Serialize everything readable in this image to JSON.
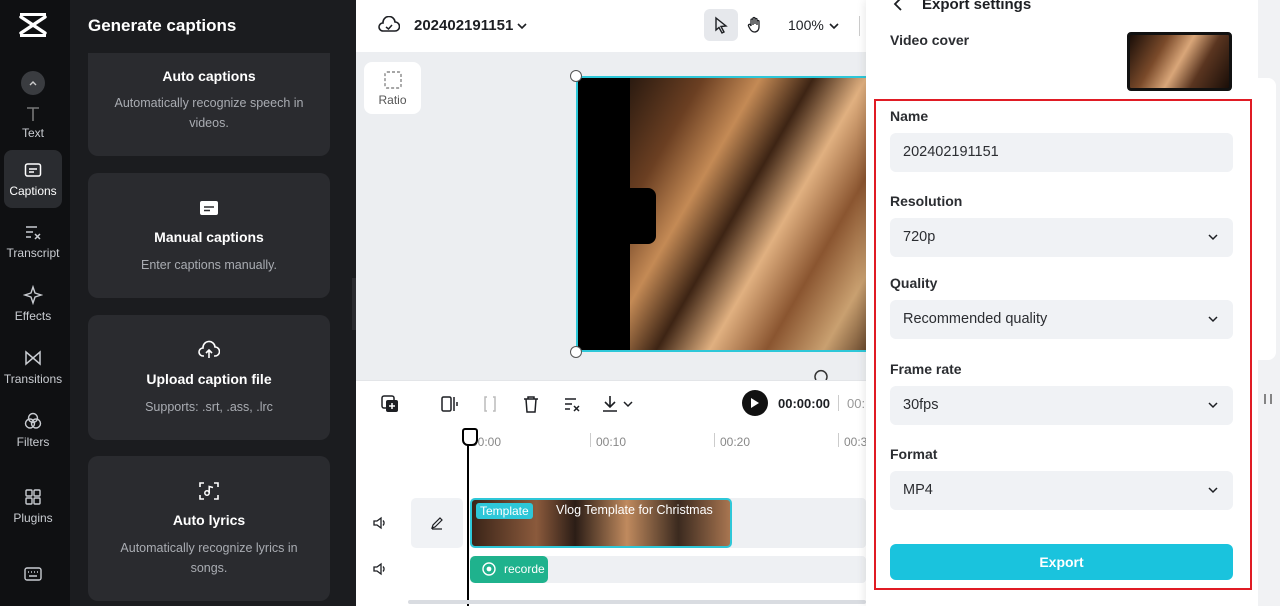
{
  "rail": {
    "items": [
      {
        "label": "Text"
      },
      {
        "label": "Captions"
      },
      {
        "label": "Transcript"
      },
      {
        "label": "Effects"
      },
      {
        "label": "Transitions"
      },
      {
        "label": "Filters"
      },
      {
        "label": "Plugins"
      }
    ]
  },
  "panel": {
    "title": "Generate captions",
    "cards": [
      {
        "title": "Auto captions",
        "desc": "Automatically recognize speech in videos."
      },
      {
        "title": "Manual captions",
        "desc": "Enter captions manually."
      },
      {
        "title": "Upload caption file",
        "desc": "Supports: .srt, .ass, .lrc"
      },
      {
        "title": "Auto lyrics",
        "desc": "Automatically recognize lyrics in songs."
      }
    ]
  },
  "topbar": {
    "project_name": "202402191151",
    "zoom": "100%"
  },
  "canvas": {
    "ratio_label": "Ratio"
  },
  "timeline": {
    "current_time": "00:00:00",
    "total_time_partial": "00:",
    "ruler": [
      "00:00",
      "00:10",
      "00:20",
      "00:3"
    ],
    "clip_badge": "Template",
    "clip_name": "Vlog Template for Christmas",
    "audio_label": "recorde"
  },
  "export": {
    "title": "Export settings",
    "video_cover_label": "Video cover",
    "name_label": "Name",
    "name_value": "202402191151",
    "resolution_label": "Resolution",
    "resolution_value": "720p",
    "quality_label": "Quality",
    "quality_value": "Recommended quality",
    "framerate_label": "Frame rate",
    "framerate_value": "30fps",
    "format_label": "Format",
    "format_value": "MP4",
    "export_button": "Export"
  },
  "colors": {
    "accent": "#1ac3dd",
    "highlight_border": "#e01b24",
    "audio_track": "#1fb28d"
  }
}
